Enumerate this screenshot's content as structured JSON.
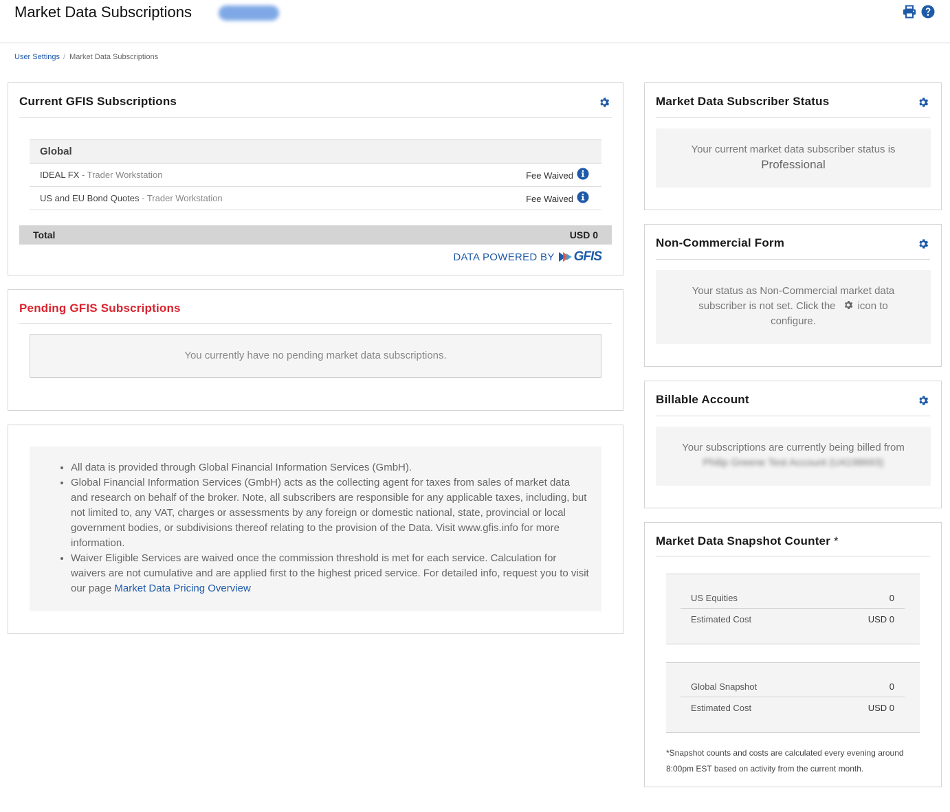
{
  "header": {
    "title": "Market Data Subscriptions",
    "badge": "Redacted",
    "print_icon": "print-icon",
    "help_icon": "question-circle-icon"
  },
  "breadcrumb": {
    "items": [
      "User Settings",
      "Market Data Subscriptions"
    ],
    "separator": "/"
  },
  "current": {
    "title": "Current GFIS Subscriptions",
    "group": "Global",
    "rows": [
      {
        "name": "IDEAL FX",
        "platform": " - Trader Workstation",
        "fee": "Fee Waived"
      },
      {
        "name": "US and EU Bond Quotes",
        "platform": " - Trader Workstation",
        "fee": "Fee Waived"
      }
    ],
    "total_label": "Total",
    "total_value": "USD 0",
    "powered_by": "DATA POWERED BY",
    "logo_text": "GFIS"
  },
  "pending": {
    "title": "Pending GFIS Subscriptions",
    "empty_message": "You currently have no pending market data subscriptions."
  },
  "info": {
    "bullets": [
      "All data is provided through Global Financial Information Services (GmbH).",
      "Global Financial Information Services (GmbH) acts as the collecting agent for taxes from sales of market data and research on behalf of the broker. Note, all subscribers are responsible for any applicable taxes, including, but not limited to, any VAT, charges or assessments by any foreign or domestic national, state, provincial or local government bodies, or subdivisions thereof relating to the provision of the Data. Visit www.gfis.info for more information.",
      "Waiver Eligible Services are waived once the commission threshold is met for each service. Calculation for waivers are not cumulative and are applied first to the highest priced service. For detailed info, request you to visit our page "
    ],
    "link_text": "Market Data Pricing Overview"
  },
  "subscriber_status": {
    "title": "Market Data Subscriber Status",
    "message": "Your current market data subscriber status is",
    "status": "Professional"
  },
  "non_commercial": {
    "title": "Non-Commercial Form",
    "message_part1": "Your status as Non-Commercial market data subscriber is not set. Click the",
    "message_part2": "icon to configure."
  },
  "billable": {
    "title": "Billable Account",
    "message": "Your subscriptions are currently being billed from",
    "account": "Philip Greene Test Account (U4198693)"
  },
  "snapshot": {
    "title": "Market Data Snapshot Counter",
    "title_suffix": "*",
    "groups": [
      {
        "label": "US Equities",
        "count": "0",
        "cost_label": "Estimated Cost",
        "cost": "USD 0"
      },
      {
        "label": "Global Snapshot",
        "count": "0",
        "cost_label": "Estimated Cost",
        "cost": "USD 0"
      }
    ],
    "footnote": "*Snapshot counts and costs are calculated every evening around 8:00pm EST based on activity from the current month."
  },
  "colors": {
    "accent": "#1e5aa8",
    "pending_title": "#d9232e",
    "gear": "#1e5aa8"
  }
}
